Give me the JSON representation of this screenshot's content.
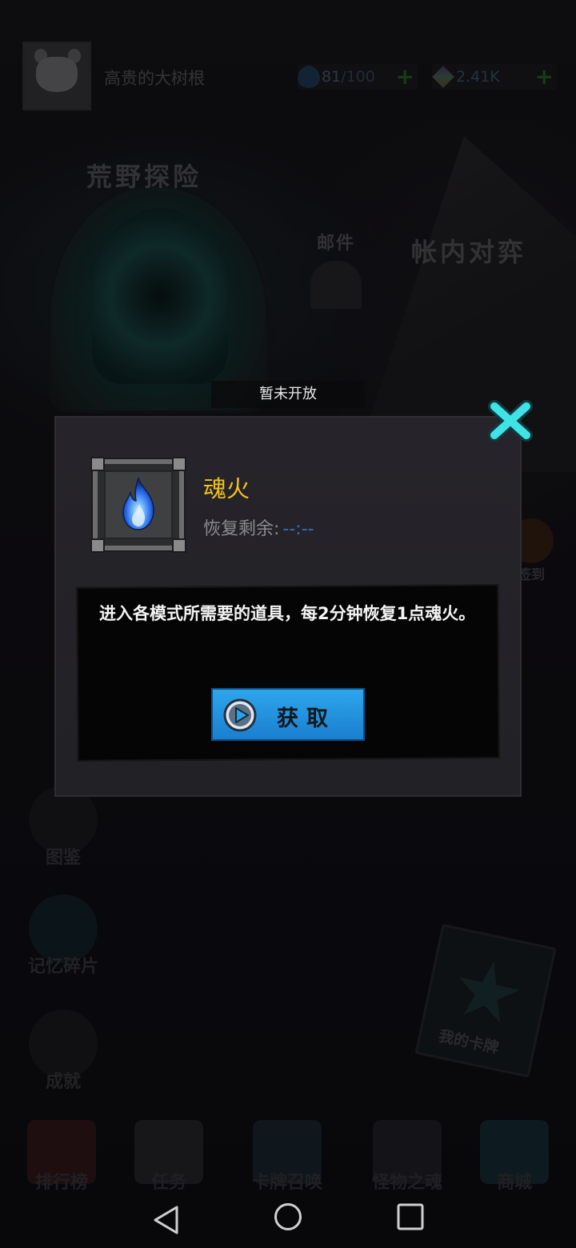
{
  "header": {
    "username": "高贵的大树根",
    "soul_fire": {
      "current": "81",
      "max": "/100",
      "plus": "+"
    },
    "gems": {
      "value": "2.41K",
      "plus": "+"
    }
  },
  "background": {
    "wild_adventure": "荒野探险",
    "mail": "邮件",
    "tent_duel": "帐内对弈",
    "daily_sign": "签到",
    "my_cards": "我的卡牌",
    "side_menu": [
      "图鉴",
      "记忆碎片",
      "成就"
    ],
    "bottom_nav": [
      "排行榜",
      "任务",
      "卡牌召唤",
      "怪物之魂",
      "商城"
    ]
  },
  "toast": "暂未开放",
  "dialog": {
    "item_name": "魂火",
    "recover_label": "恢复剩余:",
    "recover_timer": "--:--",
    "description": "进入各模式所需要的道具，每2分钟恢复1点魂火。",
    "get_button": "获取"
  },
  "colors": {
    "item_name": "#f1c21b",
    "button_blue": "#2ea6ec",
    "close_cyan": "#3fe3e6",
    "flame_blue": "#3a7dff"
  },
  "icons": {
    "close": "close-x-icon",
    "item": "blue-flame-icon",
    "button": "play-icon"
  }
}
